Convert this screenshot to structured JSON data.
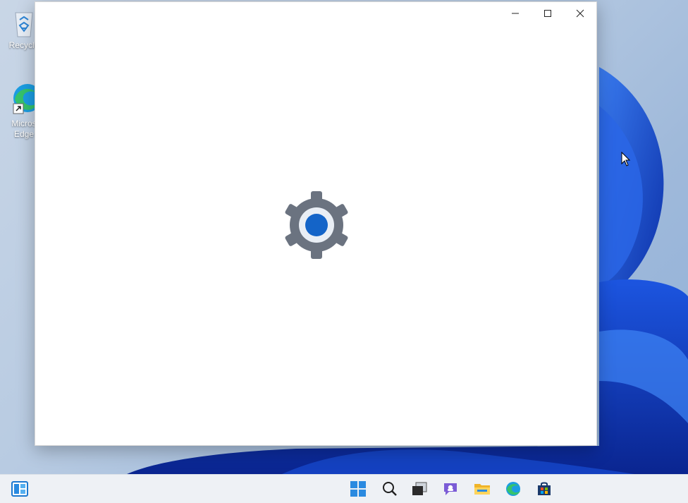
{
  "desktop": {
    "icons": [
      {
        "name": "recycle-bin",
        "label": "Recycle"
      },
      {
        "name": "microsoft-edge",
        "label_line1": "Micros",
        "label_line2": "Edge"
      }
    ]
  },
  "window": {
    "caption_buttons": [
      "minimize",
      "maximize",
      "close"
    ],
    "splash_icon": "settings-gear-icon"
  },
  "taskbar": {
    "items": [
      "widgets",
      "start",
      "search",
      "task-view",
      "chat",
      "file-explorer",
      "edge",
      "microsoft-store"
    ]
  },
  "colors": {
    "accent": "#1464c8",
    "gear": "#6b7380",
    "window_bg": "#ffffff",
    "taskbar_bg": "#eef1f5"
  }
}
